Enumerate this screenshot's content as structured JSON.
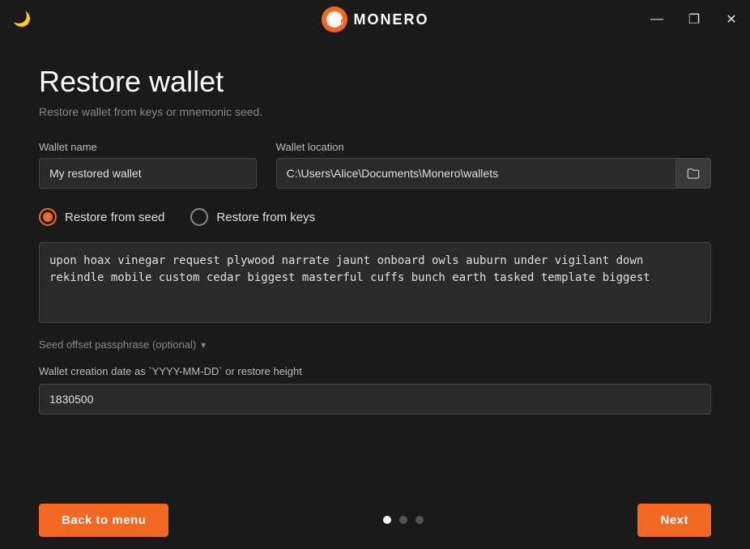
{
  "titleBar": {
    "appName": "MONERO",
    "moonIcon": "🌙",
    "minimizeIcon": "—",
    "maximizeIcon": "❐",
    "closeIcon": "✕"
  },
  "page": {
    "title": "Restore wallet",
    "subtitle": "Restore wallet from keys or mnemonic seed."
  },
  "form": {
    "walletNameLabel": "Wallet name",
    "walletNameValue": "My restored wallet",
    "walletLocationLabel": "Wallet location",
    "walletLocationValue": "C:\\Users\\Alice\\Documents\\Monero\\wallets",
    "restoreFromSeedLabel": "Restore from seed",
    "restoreFromKeysLabel": "Restore from keys",
    "seedValue": "upon hoax vinegar request plywood narrate jaunt onboard owls auburn under vigilant down rekindle mobile custom cedar biggest masterful cuffs bunch earth tasked template biggest",
    "passphraseLabel": "Seed offset passphrase (optional)",
    "dateLabel": "Wallet creation date as `YYYY-MM-DD` or restore height",
    "dateValue": "1830500"
  },
  "footer": {
    "backToMenuLabel": "Back to menu",
    "nextLabel": "Next",
    "dots": [
      {
        "active": true
      },
      {
        "active": false
      },
      {
        "active": false
      }
    ]
  }
}
